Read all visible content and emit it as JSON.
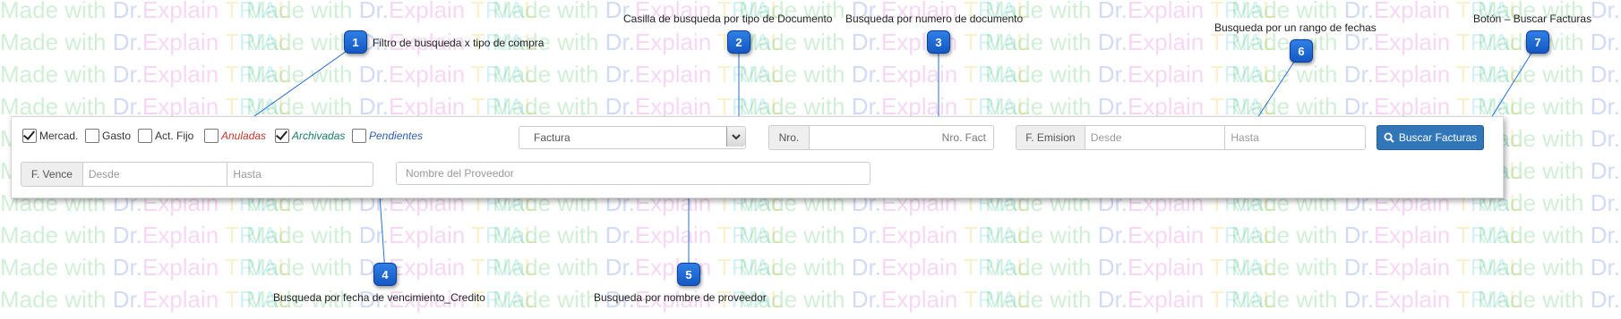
{
  "watermark": {
    "parts": [
      "Made",
      " with ",
      "Dr.",
      "Explain",
      " T",
      "RIA",
      "L"
    ]
  },
  "filters": {
    "checkboxes": [
      {
        "label": "Mercad.",
        "checked": true,
        "style": "plain"
      },
      {
        "label": "Gasto",
        "checked": false,
        "style": "plain"
      },
      {
        "label": "Act. Fijo",
        "checked": false,
        "style": "plain"
      },
      {
        "label": "Anuladas",
        "checked": false,
        "style": "italic",
        "color": "#c0392b"
      },
      {
        "label": "Archivadas",
        "checked": true,
        "style": "italic",
        "color": "#1a7a6e"
      },
      {
        "label": "Pendientes",
        "checked": false,
        "style": "italic",
        "color": "#2a5db0"
      }
    ]
  },
  "document_type": {
    "selected": "Factura"
  },
  "doc_number": {
    "prefix": "Nro.",
    "placeholder": "Nro. Fact"
  },
  "emission": {
    "prefix": "F. Emision",
    "from_placeholder": "Desde",
    "to_placeholder": "Hasta"
  },
  "search_button": {
    "label": "Buscar Facturas",
    "color": "#3176b8"
  },
  "due_date": {
    "prefix": "F. Vence",
    "from_placeholder": "Desde",
    "to_placeholder": "Hasta"
  },
  "supplier": {
    "placeholder": "Nombre del Proveedor"
  },
  "callouts": [
    {
      "number": "1",
      "text": "Filtro de busqueda x tipo de compra"
    },
    {
      "number": "2",
      "text": "Casilla de busqueda por tipo de Documento"
    },
    {
      "number": "3",
      "text": "Busqueda por numero de documento"
    },
    {
      "number": "4",
      "text": "Busqueda por fecha de vencimiento_Credito"
    },
    {
      "number": "5",
      "text": "Busqueda por nombre de proveedor"
    },
    {
      "number": "6",
      "text": "Busqueda por un rango de fechas"
    },
    {
      "number": "7",
      "text": "Botón – Buscar Facturas"
    }
  ]
}
